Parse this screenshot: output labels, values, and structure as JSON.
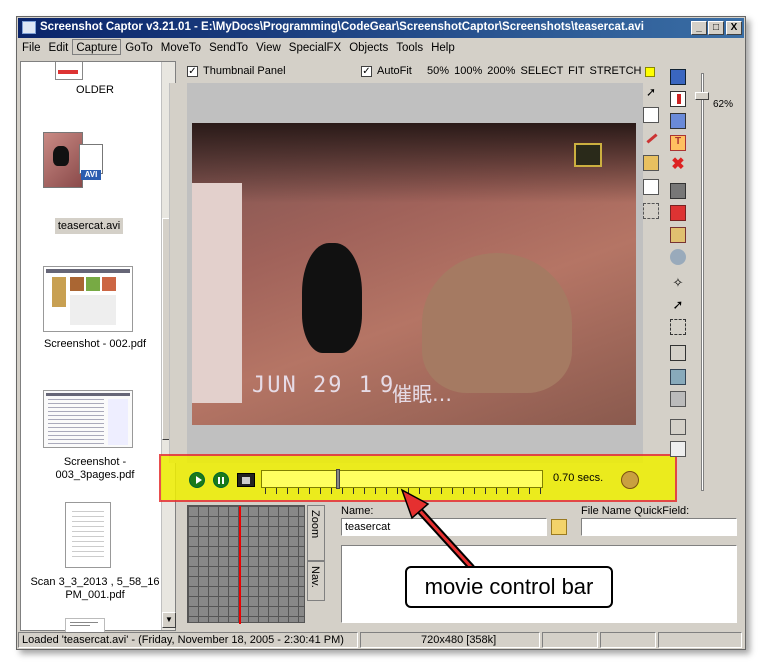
{
  "window": {
    "title": "Screenshot Captor v3.21.01 - E:\\MyDocs\\Programming\\CodeGear\\ScreenshotCaptor\\Screenshots\\teasercat.avi",
    "min": "_",
    "max": "□",
    "close": "X"
  },
  "menu": [
    "File",
    "Edit",
    "Capture",
    "GoTo",
    "MoveTo",
    "SendTo",
    "View",
    "SpecialFX",
    "Objects",
    "Tools",
    "Help"
  ],
  "sidebar": {
    "items": [
      {
        "label": "OLDER"
      },
      {
        "label": "teasercat.avi",
        "badge": "AVI",
        "selected": true
      },
      {
        "label": "Screenshot - 002.pdf"
      },
      {
        "label": "Screenshot -\n003_3pages.pdf"
      },
      {
        "label": "Scan 3_3_2013 , 5_58_16\nPM_001.pdf"
      }
    ]
  },
  "viewer_toolbar": {
    "thumbnail_panel": "Thumbnail Panel",
    "autofit": "AutoFit",
    "zoom_options": [
      "50%",
      "100%",
      "200%",
      "SELECT",
      "FIT",
      "STRETCH"
    ]
  },
  "video": {
    "caption_date": "JUN 29 1",
    "caption_tail": "9",
    "caption_cjk": "催眠…"
  },
  "movie_control": {
    "time": "0.70 secs.",
    "progress": 0.27
  },
  "zoom_slider": {
    "value": "62%",
    "level": 0.62
  },
  "side_tabs": [
    "Zoom",
    "Nav."
  ],
  "name_panel": {
    "name_label": "Name:",
    "name_value": "teasercat",
    "quickfield_label": "File Name QuickField:",
    "quickfield_value": ""
  },
  "callout": "movie control bar",
  "status": {
    "message": "Loaded 'teasercat.avi'  - (Friday, November 18, 2005 - 2:30:41 PM)",
    "dimensions": "720x480  [358k]"
  },
  "colors": {
    "title_start": "#0a246a",
    "title_end": "#3a6ea5",
    "control_bar": "#f0f000",
    "highlight_border": "#e53030",
    "arrow": "#e53030"
  }
}
